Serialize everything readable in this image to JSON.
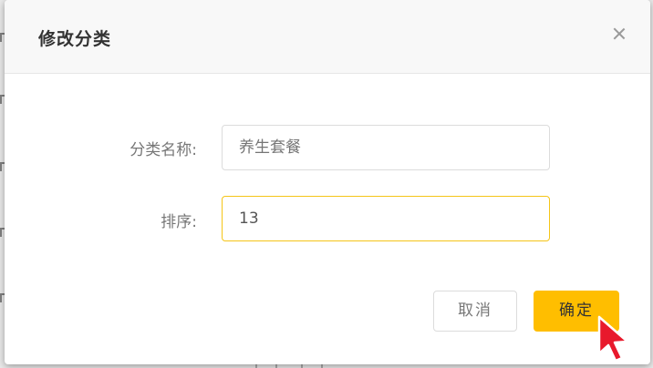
{
  "dialog": {
    "title": "修改分类",
    "close_icon": "close-icon"
  },
  "form": {
    "name_label": "分类名称:",
    "name_placeholder": "养生套餐",
    "sort_label": "排序:",
    "sort_value": "13"
  },
  "buttons": {
    "cancel_label": "取消",
    "ok_label": "确定"
  },
  "colors": {
    "primary": "#ffbe00",
    "focus_border": "#f5c518",
    "cursor": "#e8192c"
  },
  "icons": {
    "cursor": "mouse-pointer-icon"
  }
}
